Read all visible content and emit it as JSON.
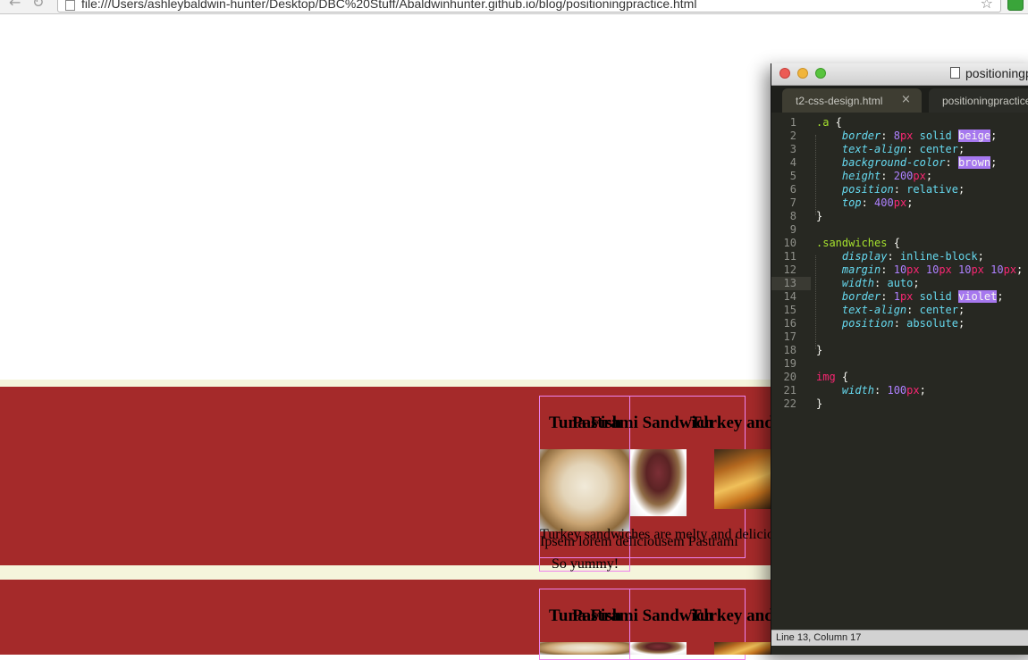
{
  "browser": {
    "url": "file:///Users/ashleybaldwin-hunter/Desktop/DBC%20Stuff/Abaldwinhunter.github.io/blog/positioningpractice.html",
    "back_icon": "back-arrow-icon",
    "reload_icon": "reload-icon",
    "star_icon": "star-icon"
  },
  "page": {
    "colors": {
      "beige": "#f5f5dc",
      "brown": "#a52a2a",
      "violet": "#ee82ee"
    },
    "blocks": [
      {
        "titles": [
          "Tuna Fish",
          "Pastrami Sandwich",
          "Turkey and"
        ],
        "texts": [
          "Turkey sandwiches are melty and delicio",
          "Ipsem lorem deliciousem Pastrami",
          "So yummy!"
        ]
      },
      {
        "titles": [
          "Tuna Fish",
          "Pastrami Sandwich",
          "Turkey and"
        ]
      }
    ]
  },
  "editor": {
    "window_title": "positioningpractice.html",
    "tabs": [
      {
        "label": "t2-css-design.html",
        "close": "×"
      },
      {
        "label": "positioningpractice.html"
      }
    ],
    "status": "Line 13, Column 17",
    "colors": {
      "background": "#272822",
      "selector": "#a6e22e",
      "property": "#66d9ef",
      "number": "#ae81ff",
      "keyword": "#f92672",
      "highlight": "#a678ef"
    },
    "lines": [
      ".a {",
      "    border: 8px solid beige;",
      "    text-align: center;",
      "    background-color: brown;",
      "    height: 200px;",
      "    position: relative;",
      "    top: 400px;",
      "}",
      "",
      ".sandwiches {",
      "    display: inline-block;",
      "    margin: 10px 10px 10px 10px;",
      "    width: auto;",
      "    border: 1px solid violet;",
      "    text-align: center;",
      "    position: absolute;",
      "",
      "}",
      "",
      "img {",
      "    width: 100px;",
      "}"
    ]
  }
}
